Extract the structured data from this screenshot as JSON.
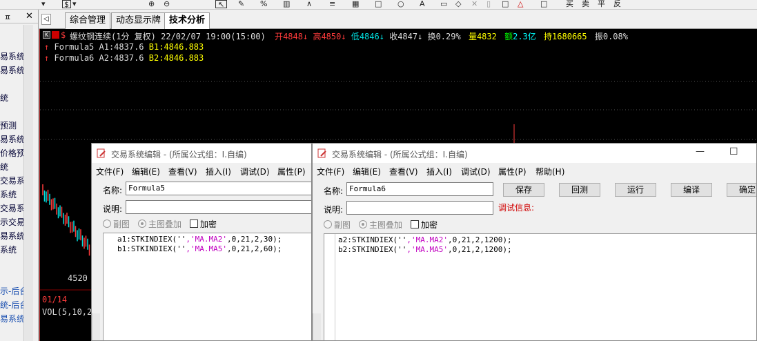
{
  "toolbar": {
    "icons": [
      "▾",
      "$",
      "▾",
      "⊕",
      "⊖",
      "↖",
      "✎",
      "%",
      "▥",
      "∧",
      "≡",
      "▦",
      "□",
      "○",
      "A",
      "▭",
      "◇",
      "✕",
      "▯",
      "□",
      "△",
      "□"
    ],
    "right_labels": [
      "买",
      "卖",
      "平",
      "反"
    ]
  },
  "left_panel": {
    "pin": "ㅍ",
    "close": "✕",
    "items": [
      "易系统",
      "易系统",
      "",
      "统",
      "",
      "预测",
      "易系统",
      "价格预",
      "统",
      "交易系",
      "系统",
      "交易系",
      "示交易",
      "易系统",
      "系统",
      "",
      "",
      "示-后台",
      "统-后台",
      "易系统"
    ]
  },
  "tabs": [
    "综合管理",
    "动态显示牌",
    "技术分析"
  ],
  "chart": {
    "header": {
      "symbol": "螺纹钢连续(1分 复权) 22/02/07 19:00(15:00)",
      "open": "开4848",
      "high": "高4850",
      "low": "低4846",
      "close": "收4847",
      "turnover": "换0.29%",
      "volume_label": "量",
      "volume_value": "4832",
      "amount_label": "额",
      "amount_value": "2.3亿",
      "hold_label": "持",
      "hold_value": "1680665",
      "amplitude": "振0.08%"
    },
    "line1": {
      "name": "Formula5",
      "a": "A1:4837.6",
      "b": "B1:4846.883"
    },
    "line2": {
      "name": "Formula6",
      "a": "A2:4837.6",
      "b": "B2:4846.883"
    },
    "price_label": "4520",
    "date_label": "01/14",
    "vol_label": "VOL(5,10,2"
  },
  "dialog1": {
    "title": "交易系统编辑 - (所属公式组：I.自编)",
    "menus": [
      "文件(F)",
      "编辑(E)",
      "查看(V)",
      "插入(I)",
      "调试(D)",
      "属性(P)"
    ],
    "name_label": "名称:",
    "name_value": "Formula5",
    "desc_label": "说明:",
    "opt_sub": "副图",
    "opt_main": "主图叠加",
    "opt_encrypt": "加密",
    "code1_a": "a1:STKINDIEX(''",
    "code1_s1": ",'MA.MA2'",
    "code1_b": ",0,21,2,30);",
    "code2_a": "b1:STKINDIEX(''",
    "code2_s1": ",'MA.MA5'",
    "code2_b": ",0,21,2,60);"
  },
  "dialog2": {
    "title": "交易系统编辑 - (所属公式组：I.自编)",
    "menus": [
      "文件(F)",
      "编辑(E)",
      "查看(V)",
      "插入(I)",
      "调试(D)",
      "属性(P)",
      "帮助(H)"
    ],
    "name_label": "名称:",
    "name_value": "Formula6",
    "desc_label": "说明:",
    "debug_label": "调试信息:",
    "buttons": [
      "保存",
      "回测",
      "运行",
      "编译",
      "确定"
    ],
    "opt_sub": "副图",
    "opt_main": "主图叠加",
    "opt_encrypt": "加密",
    "code1_a": "a2:STKINDIEX(''",
    "code1_s1": ",'MA.MA2'",
    "code1_b": ",0,21,2,1200);",
    "code2_a": "b2:STKINDIEX(''",
    "code2_s1": ",'MA.MA5'",
    "code2_b": ",0,21,2,1200);",
    "minimize": "—",
    "maximize": "☐"
  },
  "colors": {
    "up": "#ff3b3b",
    "down": "#00e0e0",
    "yellow": "#ffff00",
    "green": "#00ff00",
    "white": "#ffffff",
    "debug_red": "#d00000"
  }
}
